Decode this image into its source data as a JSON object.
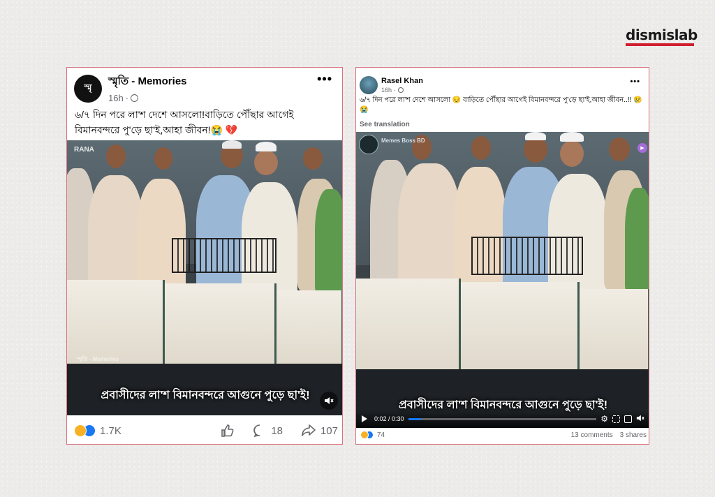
{
  "brand": {
    "name": "dismislab"
  },
  "post_left": {
    "page_name": "স্মৃতি - Memories",
    "time": "16h",
    "caption": "৬/৭ দিন পরে লা'শ দেশে আসলো!বাড়িতে পৌঁছার আগেই বিমানবন্দরে পু'ড়ে ছা'ই,আহা জীবন!😭 💔",
    "video_watermark_top": "RANA",
    "video_watermark_mid": "স্মৃতি - Memories",
    "video_subtitle": "প্রবাসীদের লা'শ বিমানবন্দরে আগুনে পুড়ে ছা'ই!",
    "reaction_count": "1.7K",
    "comment_count": "18",
    "share_count": "107"
  },
  "post_right": {
    "page_name": "Rasel Khan",
    "time": "16h",
    "caption": "৬/৭ দিন পরে লা'শ দেশে আসলো 😔 বাড়িতে পৌঁছার আগেই বিমানবন্দরে পু'ড়ে ছা'ই,আহা জীবন..!! 😢😭",
    "see_translation": "See translation",
    "video_watermark": "Memes Boss BD",
    "video_subtitle": "প্রবাসীদের লা'শ বিমানবন্দরে আগুনে পুড়ে ছা'ই!",
    "video_time": "0:02 / 0:30",
    "video_progress": 0.07,
    "reaction_count": "74",
    "comments": "13 comments",
    "shares": "3 shares"
  },
  "colors": {
    "brand_red": "#d0202e",
    "post_border": "#d9727c",
    "like_blue": "#1877f2",
    "sad_yellow": "#f7b125"
  },
  "icons": [
    "globe-icon",
    "more-dots-icon",
    "mute-icon",
    "play-icon",
    "settings-icon",
    "fullscreen-icon",
    "like-icon",
    "comment-icon",
    "share-icon"
  ]
}
